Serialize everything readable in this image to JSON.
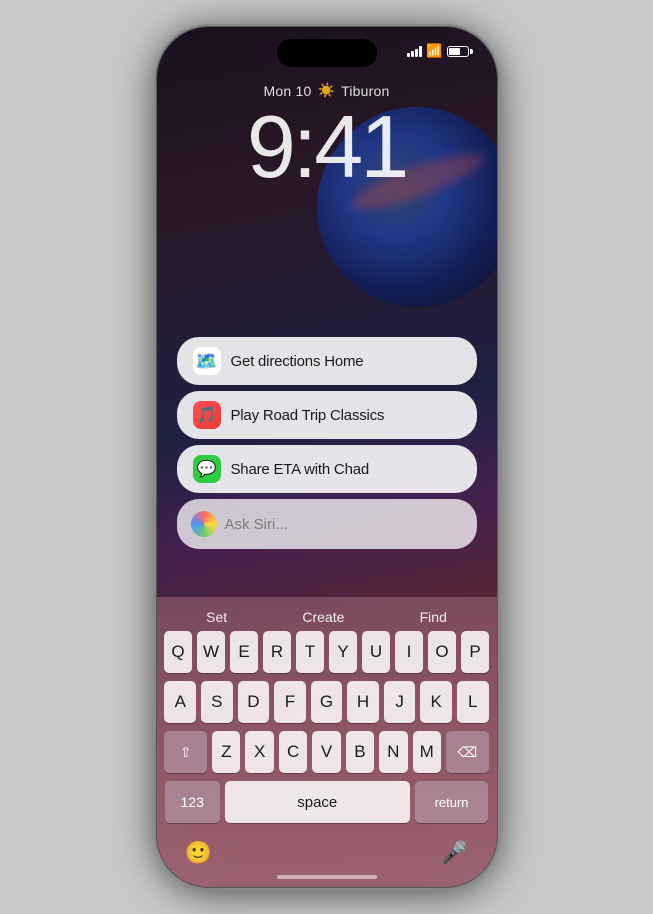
{
  "phone": {
    "status_bar": {
      "signal_label": "Signal",
      "wifi_label": "WiFi",
      "battery_label": "Battery"
    },
    "lock_screen": {
      "date_text": "Mon 10",
      "weather_text": "Tiburon",
      "time": "9:41"
    },
    "suggestions": [
      {
        "id": "directions",
        "text": "Get directions Home",
        "icon_type": "maps"
      },
      {
        "id": "music",
        "text": "Play Road Trip Classics",
        "icon_type": "music"
      },
      {
        "id": "messages",
        "text": "Share ETA with Chad",
        "icon_type": "messages"
      }
    ],
    "siri_input": {
      "placeholder": "Ask Siri..."
    },
    "keyboard": {
      "quick_suggestions": [
        "Set",
        "Create",
        "Find"
      ],
      "rows": [
        [
          "Q",
          "W",
          "E",
          "R",
          "T",
          "Y",
          "U",
          "I",
          "O",
          "P"
        ],
        [
          "A",
          "S",
          "D",
          "F",
          "G",
          "H",
          "J",
          "K",
          "L"
        ],
        [
          "Z",
          "X",
          "C",
          "V",
          "B",
          "N",
          "M"
        ]
      ],
      "bottom_row": {
        "numbers_label": "123",
        "space_label": "space",
        "return_label": "return"
      }
    }
  }
}
